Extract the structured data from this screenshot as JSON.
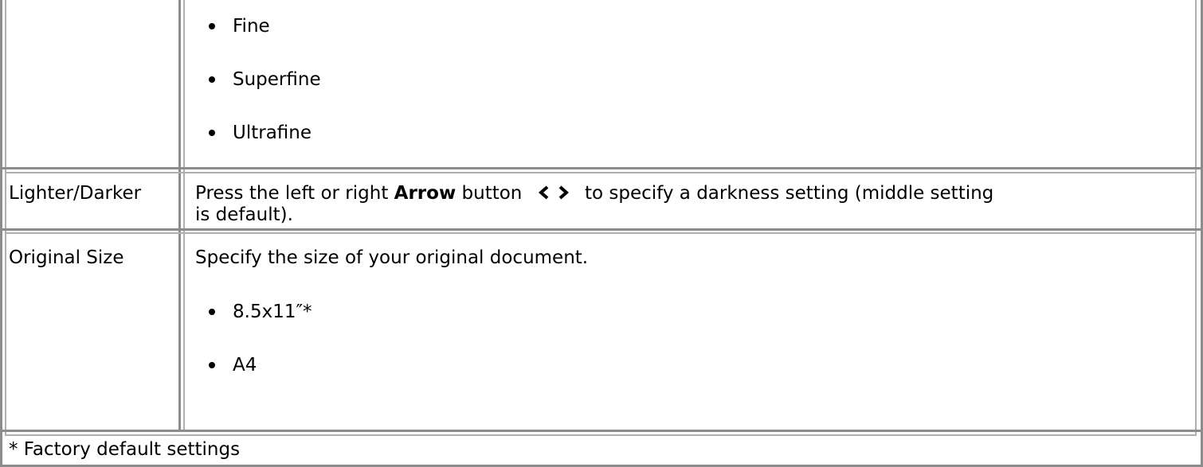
{
  "row_quality": {
    "options": [
      "Fine",
      "Superfine",
      "Ultrafine"
    ]
  },
  "row_lighter_darker": {
    "label": "Lighter/Darker",
    "desc_part1": "Press the left or right ",
    "desc_bold": "Arrow",
    "desc_part2": " button",
    "desc_part3": " to specify a darkness setting (middle setting",
    "desc_line2": "is default)."
  },
  "row_original_size": {
    "label": "Original Size",
    "desc": "Specify the size of your original document.",
    "options": [
      "8.5x11″*",
      "A4"
    ]
  },
  "footnote": "* Factory default settings",
  "icons": [
    "arrow-left-icon",
    "arrow-right-icon"
  ]
}
